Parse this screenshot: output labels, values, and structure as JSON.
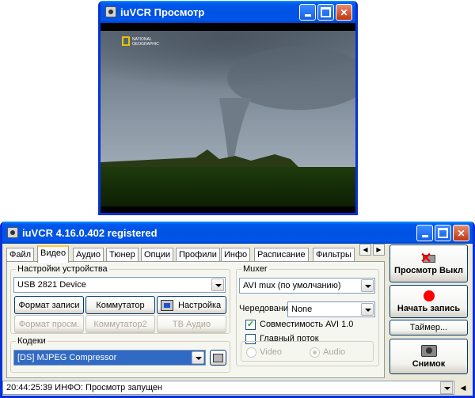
{
  "preview": {
    "title": "iuVCR Просмотр",
    "watermark": "NATIONAL GEOGRAPHIC"
  },
  "main": {
    "title": "iuVCR 4.16.0.402 registered",
    "tabs": [
      "Файл",
      "Видео",
      "Аудио",
      "Тюнер",
      "Опции",
      "Профили",
      "Инфо",
      "Расписание",
      "Фильтры"
    ],
    "device_group": "Настройки устройства",
    "device_value": "USB 2821 Device",
    "btn_format": "Формат записи",
    "btn_switch": "Коммутатор",
    "btn_settings": "Настройка",
    "btn_format_preview": "Формат просм.",
    "btn_switch2": "Коммутатор2",
    "btn_tv_audio": "ТВ Аудио",
    "codecs_group": "Кодеки",
    "codec_value": "[DS] MJPEG Compressor",
    "muxer_group": "Muxer",
    "muxer_value": "AVI mux (по умолчанию)",
    "interleave_label": "Чередовани",
    "interleave_value": "None",
    "avi_compat_label": "Совместимость AVI 1.0",
    "main_stream_label": "Главный поток",
    "video_label": "Video",
    "audio_label": "Audio",
    "preview_off": "Просмотр Выкл",
    "start_rec": "Начать запись",
    "timer": "Таймер...",
    "snapshot": "Снимок",
    "status": "20:44:25:39 ИНФО: Просмотр запущен"
  }
}
